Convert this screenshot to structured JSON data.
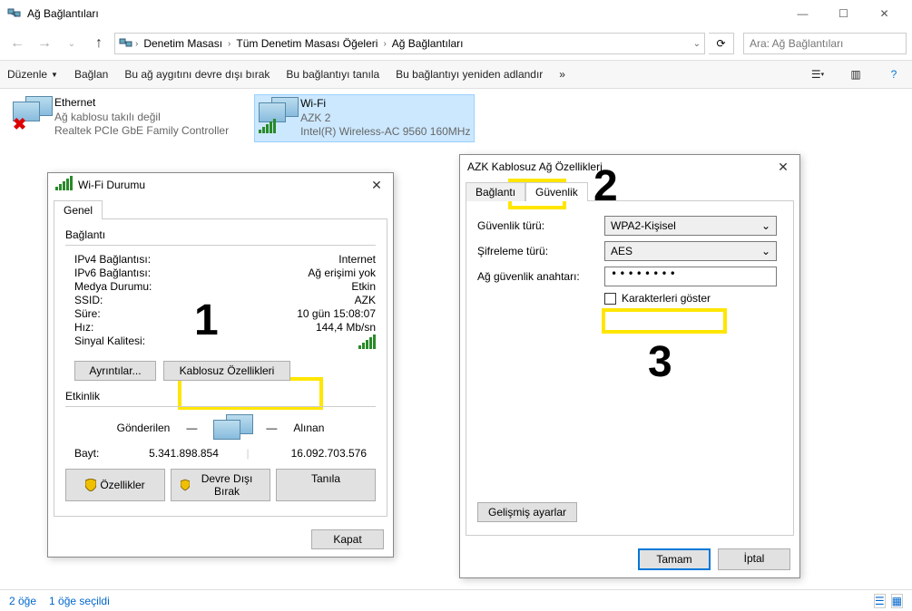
{
  "window": {
    "title": "Ağ Bağlantıları",
    "breadcrumb": [
      "Denetim Masası",
      "Tüm Denetim Masası Öğeleri",
      "Ağ Bağlantıları"
    ],
    "search_placeholder": "Ara: Ağ Bağlantıları"
  },
  "toolbar": {
    "organize": "Düzenle",
    "connect": "Bağlan",
    "disable": "Bu ağ aygıtını devre dışı bırak",
    "diagnose": "Bu bağlantıyı tanıla",
    "rename": "Bu bağlantıyı yeniden adlandır",
    "more": "»"
  },
  "connections": [
    {
      "name": "Ethernet",
      "status": "Ağ kablosu takılı değil",
      "device": "Realtek PCIe GbE Family Controller",
      "disconnected": true
    },
    {
      "name": "Wi-Fi",
      "status": "AZK 2",
      "device": "Intel(R) Wireless-AC 9560 160MHz",
      "disconnected": false
    }
  ],
  "statusbar": {
    "count": "2 öğe",
    "selected": "1 öğe seçildi"
  },
  "wifi_status": {
    "title": "Wi-Fi Durumu",
    "tab_general": "Genel",
    "group_connection": "Bağlantı",
    "rows": {
      "ipv4": {
        "l": "IPv4 Bağlantısı:",
        "v": "Internet"
      },
      "ipv6": {
        "l": "IPv6 Bağlantısı:",
        "v": "Ağ erişimi yok"
      },
      "media": {
        "l": "Medya Durumu:",
        "v": "Etkin"
      },
      "ssid": {
        "l": "SSID:",
        "v": "AZK"
      },
      "duration": {
        "l": "Süre:",
        "v": "10 gün 15:08:07"
      },
      "speed": {
        "l": "Hız:",
        "v": "144,4 Mb/sn"
      },
      "quality": {
        "l": "Sinyal Kalitesi:",
        "v": ""
      }
    },
    "btn_details": "Ayrıntılar...",
    "btn_wireless": "Kablosuz Özellikleri",
    "group_activity": "Etkinlik",
    "activity": {
      "sent_label": "Gönderilen",
      "recv_label": "Alınan",
      "bytes_label": "Bayt:",
      "sent": "5.341.898.854",
      "recv": "16.092.703.576"
    },
    "btn_properties": "Özellikler",
    "btn_disable": "Devre Dışı Bırak",
    "btn_diagnose": "Tanıla",
    "btn_close": "Kapat"
  },
  "wifi_props": {
    "title": "AZK Kablosuz Ağ Özellikleri",
    "tab_connection": "Bağlantı",
    "tab_security": "Güvenlik",
    "sec_type_label": "Güvenlik türü:",
    "sec_type_value": "WPA2-Kişisel",
    "enc_label": "Şifreleme türü:",
    "enc_value": "AES",
    "key_label": "Ağ güvenlik anahtarı:",
    "key_value": "••••••••",
    "show_chars": "Karakterleri göster",
    "btn_advanced": "Gelişmiş ayarlar",
    "btn_ok": "Tamam",
    "btn_cancel": "İptal"
  },
  "annotations": {
    "n1": "1",
    "n2": "2",
    "n3": "3"
  }
}
